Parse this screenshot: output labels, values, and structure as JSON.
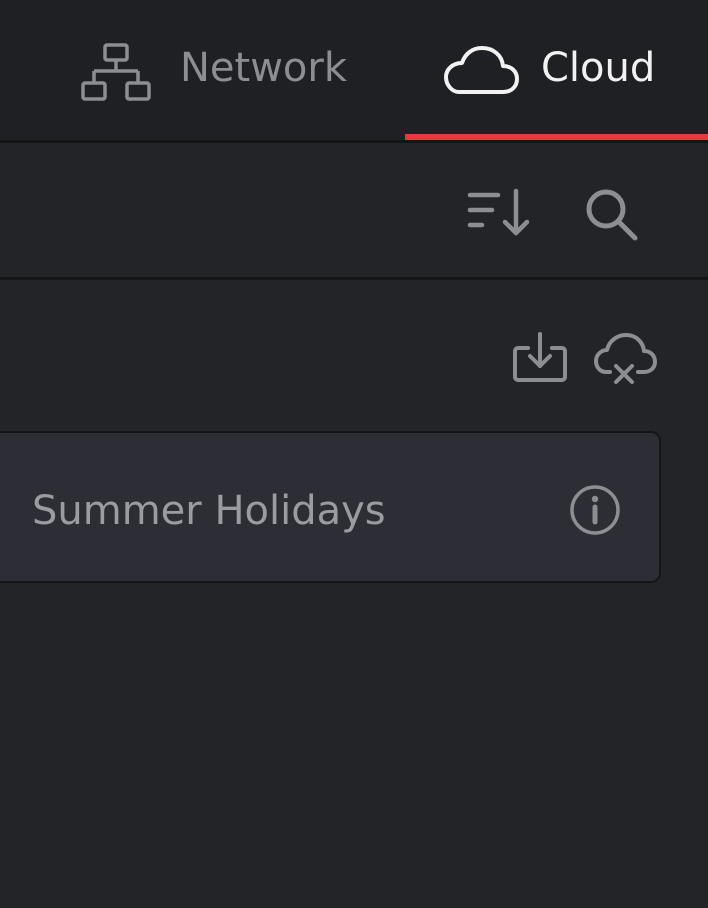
{
  "tabs": {
    "network": {
      "label": "Network",
      "icon": "network-icon"
    },
    "cloud": {
      "label": "Cloud",
      "icon": "cloud-icon",
      "active": true
    }
  },
  "toolbar": {
    "sort_icon": "sort-icon",
    "search_icon": "search-icon"
  },
  "section_actions": {
    "import_icon": "import-project-icon",
    "cloud_off_icon": "cloud-disconnect-icon"
  },
  "projects": [
    {
      "name": "Summer Holidays",
      "info_icon": "info-icon"
    }
  ],
  "colors": {
    "background": "#232428",
    "tab_bar": "#1f2024",
    "active_underline": "#e5393b",
    "card": "#2d2e35",
    "active_text": "#f2f2f3",
    "inactive_text": "#8d8e92"
  }
}
